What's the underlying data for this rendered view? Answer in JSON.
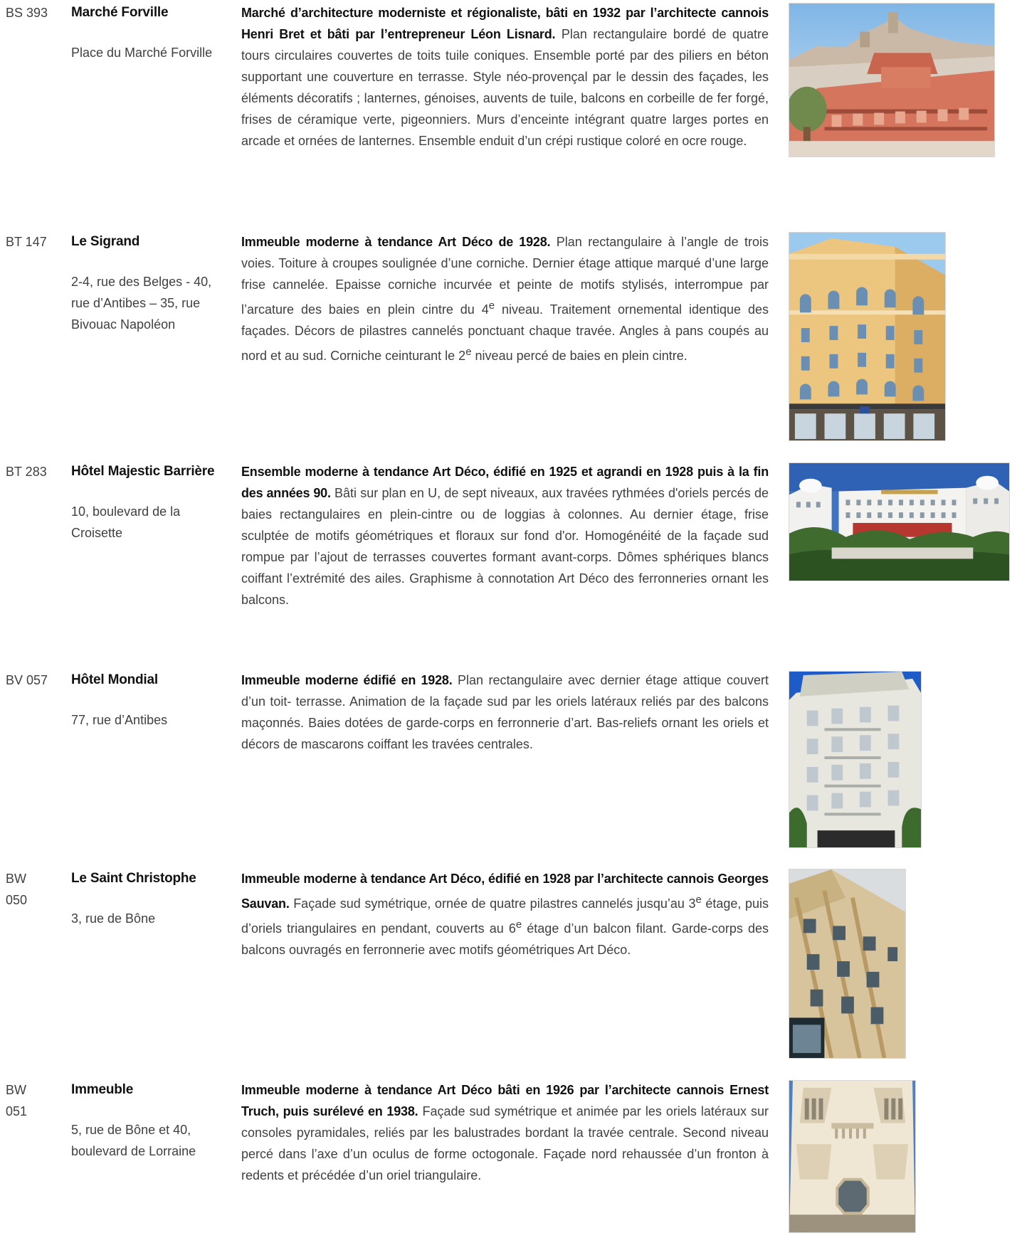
{
  "entries": [
    {
      "ref": "BS 393",
      "name": "Marché Forville",
      "address": "Place du Marché Forville",
      "lead": "Marché d’architecture moderniste et régionaliste, bâti en 1932 par l’architecte cannois Henri Bret et bâti par l’entrepreneur Léon Lisnard.",
      "text": " Plan rectangulaire bordé de quatre tours circulaires couvertes de toits tuile coniques. Ensemble porté par des piliers en béton supportant une couverture en terrasse. Style néo-provençal par le dessin des façades, les éléments décoratifs ; lanternes, génoises, auvents de tuile, balcons en corbeille de fer forgé, frises de céramique verte, pigeonniers. Murs d’enceinte intégrant quatre larges portes en arcade et ornées de lanternes. Ensemble enduit d’un crépi rustique coloré en ocre rouge."
    },
    {
      "ref": "BT 147",
      "name": "Le Sigrand",
      "address": "2-4, rue des Belges - 40, rue d’Antibes – 35, rue Bivouac Napoléon",
      "lead": "Immeuble moderne à tendance Art Déco de 1928.",
      "text_a": " Plan rectangulaire à l’angle de trois voies. Toiture à croupes soulignée d’une corniche. Dernier étage attique marqué d’une large frise cannelée. Epaisse corniche incurvée et peinte de motifs stylisés, interrompue par l’arcature des baies en plein cintre du 4",
      "sup_a": "e",
      "text_b": " niveau. Traitement ornemental identique des façades. Décors de pilastres cannelés ponctuant chaque travée. Angles à pans coupés au nord et au sud. Corniche ceinturant le 2",
      "sup_b": "e",
      "text_c": " niveau percé de baies en plein cintre."
    },
    {
      "ref": "BT 283",
      "name": "Hôtel Majestic Barrière",
      "address": "10, boulevard de la Croisette",
      "lead": "Ensemble moderne à tendance Art Déco, édifié en 1925 et agrandi en 1928 puis à la fin des années 90.",
      "text": " Bâti sur plan en U, de sept niveaux, aux travées rythmées d'oriels percés de baies rectangulaires en plein-cintre ou de loggias à colonnes. Au dernier étage, frise sculptée de motifs géométriques et floraux sur fond d'or. Homogénéité de la façade sud rompue par l’ajout de terrasses couvertes formant avant-corps. Dômes sphériques blancs coiffant l’extrémité des ailes. Graphisme à connotation Art Déco des ferronneries ornant les balcons."
    },
    {
      "ref": "BV 057",
      "name": "Hôtel Mondial",
      "address": "77, rue d’Antibes",
      "lead": "Immeuble moderne édifié en 1928.",
      "text": " Plan rectangulaire avec dernier étage attique couvert d’un toit- terrasse. Animation de la façade sud par les oriels latéraux reliés par des balcons maçonnés. Baies dotées de garde-corps en ferronnerie d’art. Bas-reliefs ornant les oriels et décors de mascarons coiffant les travées centrales."
    },
    {
      "ref": "BW 050",
      "name": "Le Saint Christophe",
      "address": "3, rue de Bône",
      "lead": "Immeuble moderne à tendance Art Déco, édifié en 1928 par l’architecte cannois Georges Sauvan.",
      "text_a": " Façade sud symétrique, ornée de quatre pilastres cannelés jusqu’au 3",
      "sup_a": "e",
      "text_b": " étage, puis d’oriels triangulaires en pendant, couverts au 6",
      "sup_b": "e",
      "text_c": " étage d’un balcon filant. Garde-corps des balcons ouvragés en ferronnerie avec motifs géométriques Art Déco."
    },
    {
      "ref": "BW 051",
      "name": "Immeuble",
      "address": "5, rue de Bône et 40, boulevard de Lorraine",
      "lead": "Immeuble moderne à tendance Art Déco bâti en 1926 par l’architecte cannois Ernest Truch, puis surélevé en 1938.",
      "text": " Façade sud symétrique et animée par les oriels latéraux sur consoles pyramidales, reliés par les balustrades bordant la travée centrale. Second niveau percé dans l’axe d’un oculus de forme octogonale. Façade nord rehaussée d’un fronton à redents et précédée d’un oriel triangulaire."
    }
  ]
}
